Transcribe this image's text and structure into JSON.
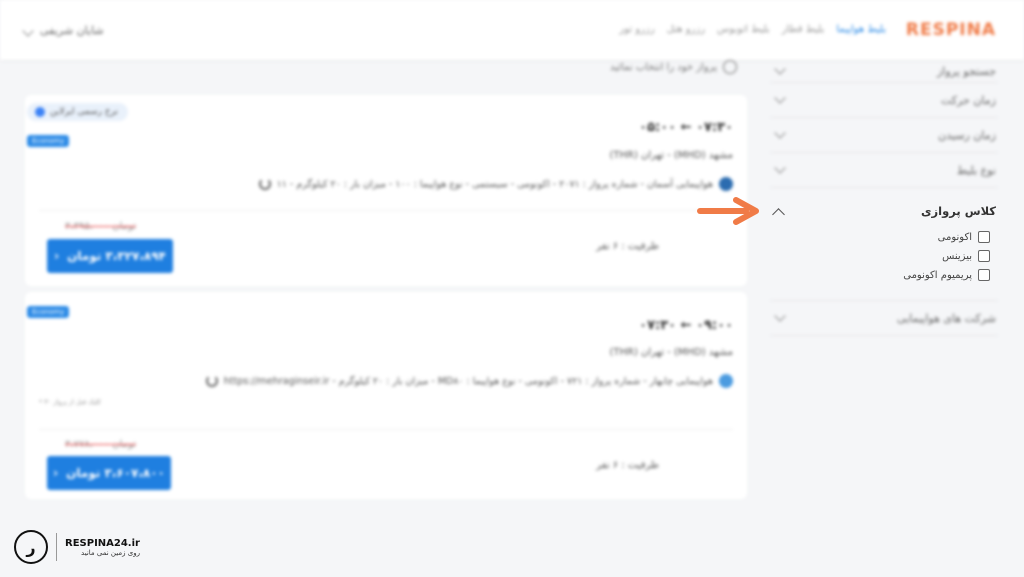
{
  "header": {
    "logo": "RESPINA",
    "nav": [
      "بلیط هواپیما",
      "بلیط قطار",
      "بلیط اتوبوس",
      "رزرو هتل",
      "رزرو تور"
    ],
    "user": "شایان شریفی"
  },
  "sidebar": {
    "filters_top": [
      "جستجو پرواز",
      "زمان حرکت",
      "زمان رسیدن",
      "نوع بلیط"
    ],
    "class_title": "کلاس پروازی",
    "class_options": [
      "اکونومی",
      "بیزینس",
      "پریمیوم اکونومی"
    ],
    "filters_bottom": [
      "شرکت های هواپیمایی"
    ]
  },
  "results": {
    "hint": "پرواز خود را انتخاب نمائید",
    "cards": [
      {
        "rate_tag": "نرخ رسمی ایرلاین",
        "badge": "Economy",
        "time": "۰۷:۳۰ ← ۰۵:۰۰",
        "route": "مشهد (MHD) - تهران (THR)",
        "info": "هواپیمایی آسمان - شماره پرواز : ۲۰۷۱ - اکونومی - سیستمی - نوع هواپیما : ۱۰۰ - میزان بار : ۲۰ کیلوگرم - ۱۱",
        "capacity": "ظرفیت : ۶ نفر",
        "old_price": "۳،۳۹۵،۰۰۰ تومان",
        "price": "۳،۳۲۷،۸۹۴ تومان"
      },
      {
        "badge": "Economy",
        "time": "۰۹:۰۰ ← ۰۷:۳۰",
        "route": "مشهد (MHD) - تهران (THR)",
        "info": "هواپیمایی چابهار - شماره پرواز : ۷۲۱ - اکونومی - نوع هواپیما : MD۸۰ - میزان بار : ۲۰ کیلوگرم - https://mehraginseir.ir",
        "note": "* ۳۰ کلیک قبل از پرواز",
        "capacity": "ظرفیت : ۶ نفر",
        "old_price": "۳،۷۷۸،۰۰۰ تومان",
        "price": "۳،۶۰۷،۸۰۰ تومان"
      }
    ]
  },
  "watermark": {
    "brand": "RESPINA24.ir",
    "tagline": "روی زمین نمی مانید"
  },
  "colors": {
    "accent": "#1f7fe0",
    "logo": "#f07b47",
    "arrow": "#f07b47"
  }
}
